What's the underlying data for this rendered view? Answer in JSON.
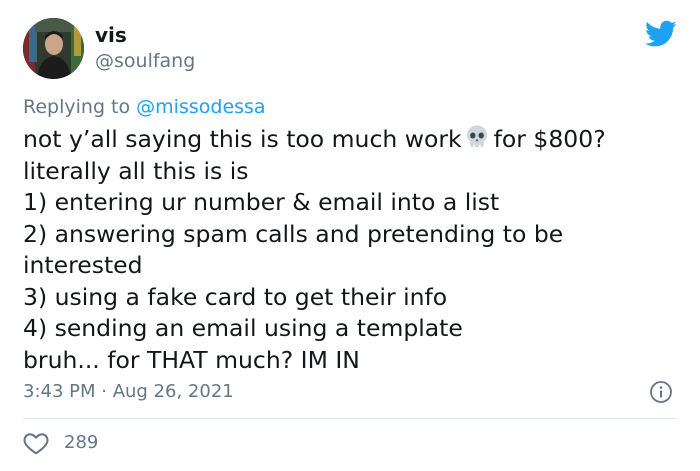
{
  "user": {
    "name": "vis",
    "handle": "@soulfang"
  },
  "reply": {
    "prefix": "Replying to",
    "mention": "@missodessa"
  },
  "tweet": {
    "line1_before_emoji": "not y’all saying this is too much work",
    "line1_emoji": "skull-emoji",
    "line1_after_emoji": "for $800?",
    "lines": [
      "literally all this is is",
      "1) entering ur number & email into a list",
      "2) answering spam calls and pretending to be",
      "interested",
      "3) using a fake card to get their info",
      "4) sending an email using a template",
      "bruh... for THAT much? IM IN"
    ]
  },
  "timestamp": "3:43 PM · Aug 26, 2021",
  "likes": {
    "count": "289"
  },
  "colors": {
    "text": "#14171a",
    "secondary": "#657786",
    "link": "#1da1f2",
    "twitter_blue": "#1da1f2",
    "divider": "#e1e8ed"
  },
  "icons": {
    "logo": "twitter-bird-icon",
    "info": "info-icon",
    "like": "heart-icon"
  }
}
